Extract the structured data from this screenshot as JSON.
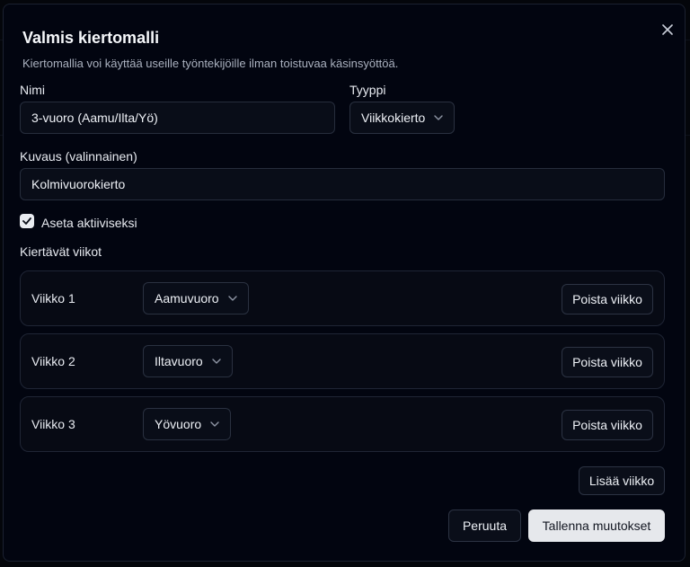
{
  "dialog": {
    "title": "Valmis kiertomalli",
    "subtitle": "Kiertomallia voi käyttää useille työntekijöille ilman toistuvaa käsinsyöttöä.",
    "close_icon": "close-icon"
  },
  "form": {
    "name_label": "Nimi",
    "name_value": "3-vuoro (Aamu/Ilta/Yö)",
    "type_label": "Tyyppi",
    "type_value": "Viikkokierto",
    "description_label": "Kuvaus (valinnainen)",
    "description_value": "Kolmivuorokierto",
    "active_label": "Aseta aktiiviseksi",
    "active_checked": true,
    "weeks_label": "Kiertävät viikot"
  },
  "weeks": [
    {
      "label": "Viikko 1",
      "shift": "Aamuvuoro",
      "remove_label": "Poista viikko"
    },
    {
      "label": "Viikko 2",
      "shift": "Iltavuoro",
      "remove_label": "Poista viikko"
    },
    {
      "label": "Viikko 3",
      "shift": "Yövuoro",
      "remove_label": "Poista viikko"
    }
  ],
  "actions": {
    "add_week": "Lisää viikko",
    "cancel": "Peruuta",
    "save": "Tallenna muutokset"
  },
  "colors": {
    "dialog_bg": "#020510",
    "border": "#1b2130",
    "primary_button": "#e6e8ec",
    "text": "#f1f3f7",
    "muted_text": "#aab1bf"
  }
}
